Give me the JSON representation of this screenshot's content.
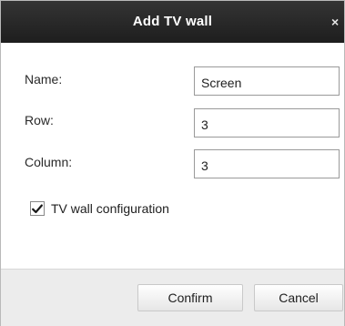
{
  "dialog": {
    "title": "Add TV wall",
    "close_symbol": "×",
    "close_icon": "close-icon"
  },
  "form": {
    "name_label": "Name:",
    "name_value": "Screen",
    "row_label": "Row:",
    "row_value": "3",
    "column_label": "Column:",
    "column_value": "3",
    "tv_wall_config_label": "TV wall configuration",
    "tv_wall_config_checked": true,
    "checkmark_icon": "checkmark-icon"
  },
  "buttons": {
    "confirm_label": "Confirm",
    "cancel_label": "Cancel"
  },
  "colors": {
    "titlebar": "#262626",
    "footer": "#ececec",
    "border": "#9a9a9a"
  }
}
